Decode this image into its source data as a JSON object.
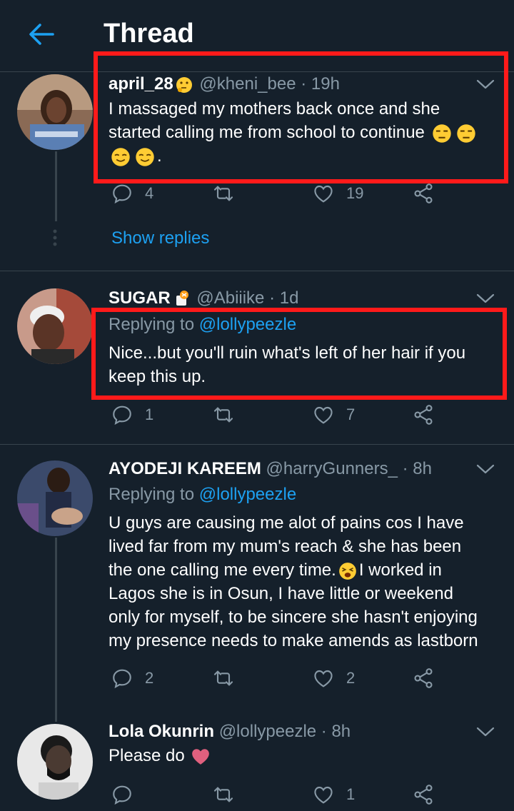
{
  "header": {
    "title": "Thread"
  },
  "tweets": [
    {
      "name": "april_28",
      "handle": "@kheni_bee",
      "time": "· 19h",
      "body_lines": [
        "I massaged my mothers back once and she",
        "started calling me from school to continue",
        "."
      ],
      "emojis": [
        "thinking-face",
        "unamused-face",
        "unamused-face",
        "smiling-face",
        "smiling-face"
      ],
      "replies": "4",
      "retweets": "",
      "likes": "19",
      "show_replies": "Show replies"
    },
    {
      "name": "SUGAR",
      "handle": "@Abiiike",
      "time": "· 1d",
      "replying_prefix": "Replying to",
      "replying_to": "@lollypeezle",
      "body_lines": [
        "Nice...but you'll ruin what's left of her hair if you",
        "keep this up."
      ],
      "emojis": [
        "sugar-emoji"
      ],
      "replies": "1",
      "retweets": "",
      "likes": "7"
    },
    {
      "name": "AYODEJI KAREEM",
      "handle": "@harryGunners_",
      "time": "· 8h",
      "replying_prefix": "Replying to",
      "replying_to": "@lollypeezle",
      "body_lines": [
        "U guys are causing me alot of pains cos I have",
        "lived far from my mum's reach & she has been",
        "the one calling me every time.",
        "I worked in",
        "Lagos she is in Osun, I have little or weekend",
        "only for myself, to be sincere she hasn't enjoying",
        "my presence needs to make amends as lastborn"
      ],
      "emojis": [
        "tired-face"
      ],
      "replies": "2",
      "retweets": "",
      "likes": "2"
    },
    {
      "name": "Lola Okunrin",
      "handle": "@lollypeezle",
      "time": "· 8h",
      "body_lines": [
        "Please do"
      ],
      "emojis": [
        "pink-heart"
      ],
      "replies": "",
      "retweets": "",
      "likes": "1"
    }
  ],
  "colors": {
    "background": "#15202b",
    "accent": "#1da1f2",
    "muted": "#8899a6",
    "highlight_box": "#ff1a1a",
    "heart": "#e0245e"
  }
}
